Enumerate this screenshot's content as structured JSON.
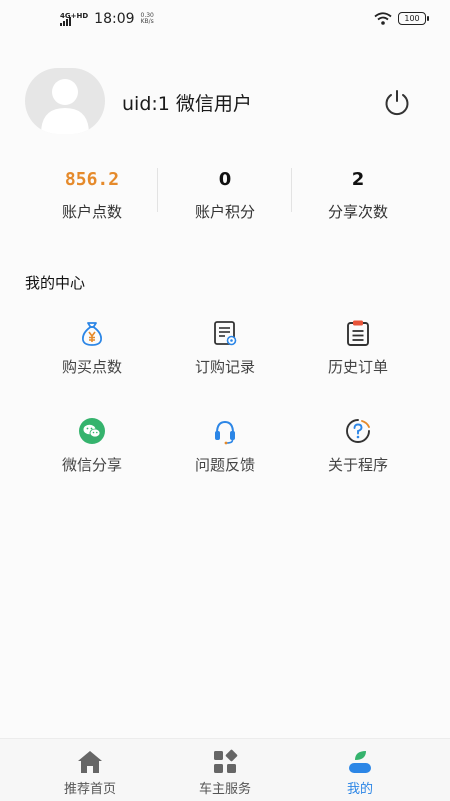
{
  "status_bar": {
    "network": "4G+HD",
    "time": "18:09",
    "speed_value": "0.30",
    "speed_unit": "KB/s",
    "battery": "100"
  },
  "profile": {
    "username": "uid:1 微信用户",
    "avatar_icon": "user-avatar-icon",
    "logout_icon": "power-icon"
  },
  "stats": [
    {
      "value": "856.2",
      "label": "账户点数"
    },
    {
      "value": "0",
      "label": "账户积分"
    },
    {
      "value": "2",
      "label": "分享次数"
    }
  ],
  "center": {
    "title": "我的中心",
    "items": [
      {
        "label": "购买点数",
        "icon": "money-bag-icon"
      },
      {
        "label": "订购记录",
        "icon": "order-list-icon"
      },
      {
        "label": "历史订单",
        "icon": "clipboard-icon"
      },
      {
        "label": "微信分享",
        "icon": "wechat-icon"
      },
      {
        "label": "问题反馈",
        "icon": "headset-icon"
      },
      {
        "label": "关于程序",
        "icon": "question-icon"
      }
    ]
  },
  "tabbar": {
    "tabs": [
      {
        "label": "推荐首页",
        "icon": "home-icon"
      },
      {
        "label": "车主服务",
        "icon": "grid-icon"
      },
      {
        "label": "我的",
        "icon": "profile-icon",
        "active": true
      }
    ]
  },
  "colors": {
    "accent_orange": "#e58a2b",
    "active_blue": "#2c86e6",
    "wechat_green": "#35b36d"
  }
}
